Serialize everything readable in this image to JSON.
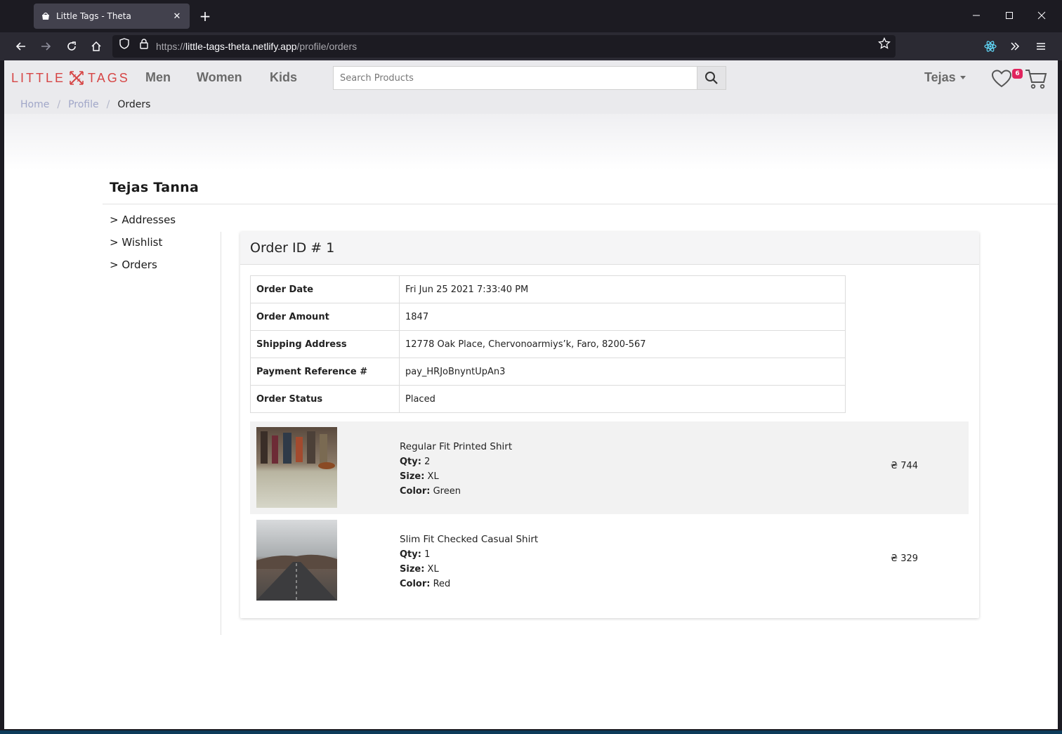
{
  "browser": {
    "tab_title": "Little Tags - Theta",
    "url_scheme": "https://",
    "url_host": "little-tags-theta.netlify.app",
    "url_path": "/profile/orders"
  },
  "site": {
    "logo_left": "LITTLE",
    "logo_right": "TAGS",
    "brand_color": "#d64545",
    "nav": [
      "Men",
      "Women",
      "Kids"
    ],
    "search_placeholder": "Search Products",
    "user_name": "Tejas",
    "wishlist_count": "6"
  },
  "breadcrumb": {
    "home": "Home",
    "profile": "Profile",
    "current": "Orders",
    "separator": "/"
  },
  "profile": {
    "full_name": "Tejas Tanna",
    "menu": [
      "> Addresses",
      "> Wishlist",
      "> Orders"
    ]
  },
  "order": {
    "title": "Order ID # 1",
    "details": [
      {
        "label": "Order Date",
        "value": "Fri Jun 25 2021 7:33:40 PM"
      },
      {
        "label": "Order Amount",
        "value": "1847"
      },
      {
        "label": "Shipping Address",
        "value": "12778 Oak Place, Chervonoarmiys’k, Faro, 8200-567"
      },
      {
        "label": "Payment Reference #",
        "value": "pay_HRJoBnyntUpAn3"
      },
      {
        "label": "Order Status",
        "value": "Placed"
      }
    ],
    "items": [
      {
        "name": "Regular Fit Printed Shirt",
        "qty_label": "Qty:",
        "qty": "2",
        "size_label": "Size:",
        "size": "XL",
        "color_label": "Color:",
        "color": "Green",
        "price": "₴ 744"
      },
      {
        "name": "Slim Fit Checked Casual Shirt",
        "qty_label": "Qty:",
        "qty": "1",
        "size_label": "Size:",
        "size": "XL",
        "color_label": "Color:",
        "color": "Red",
        "price": "₴ 329"
      }
    ]
  }
}
